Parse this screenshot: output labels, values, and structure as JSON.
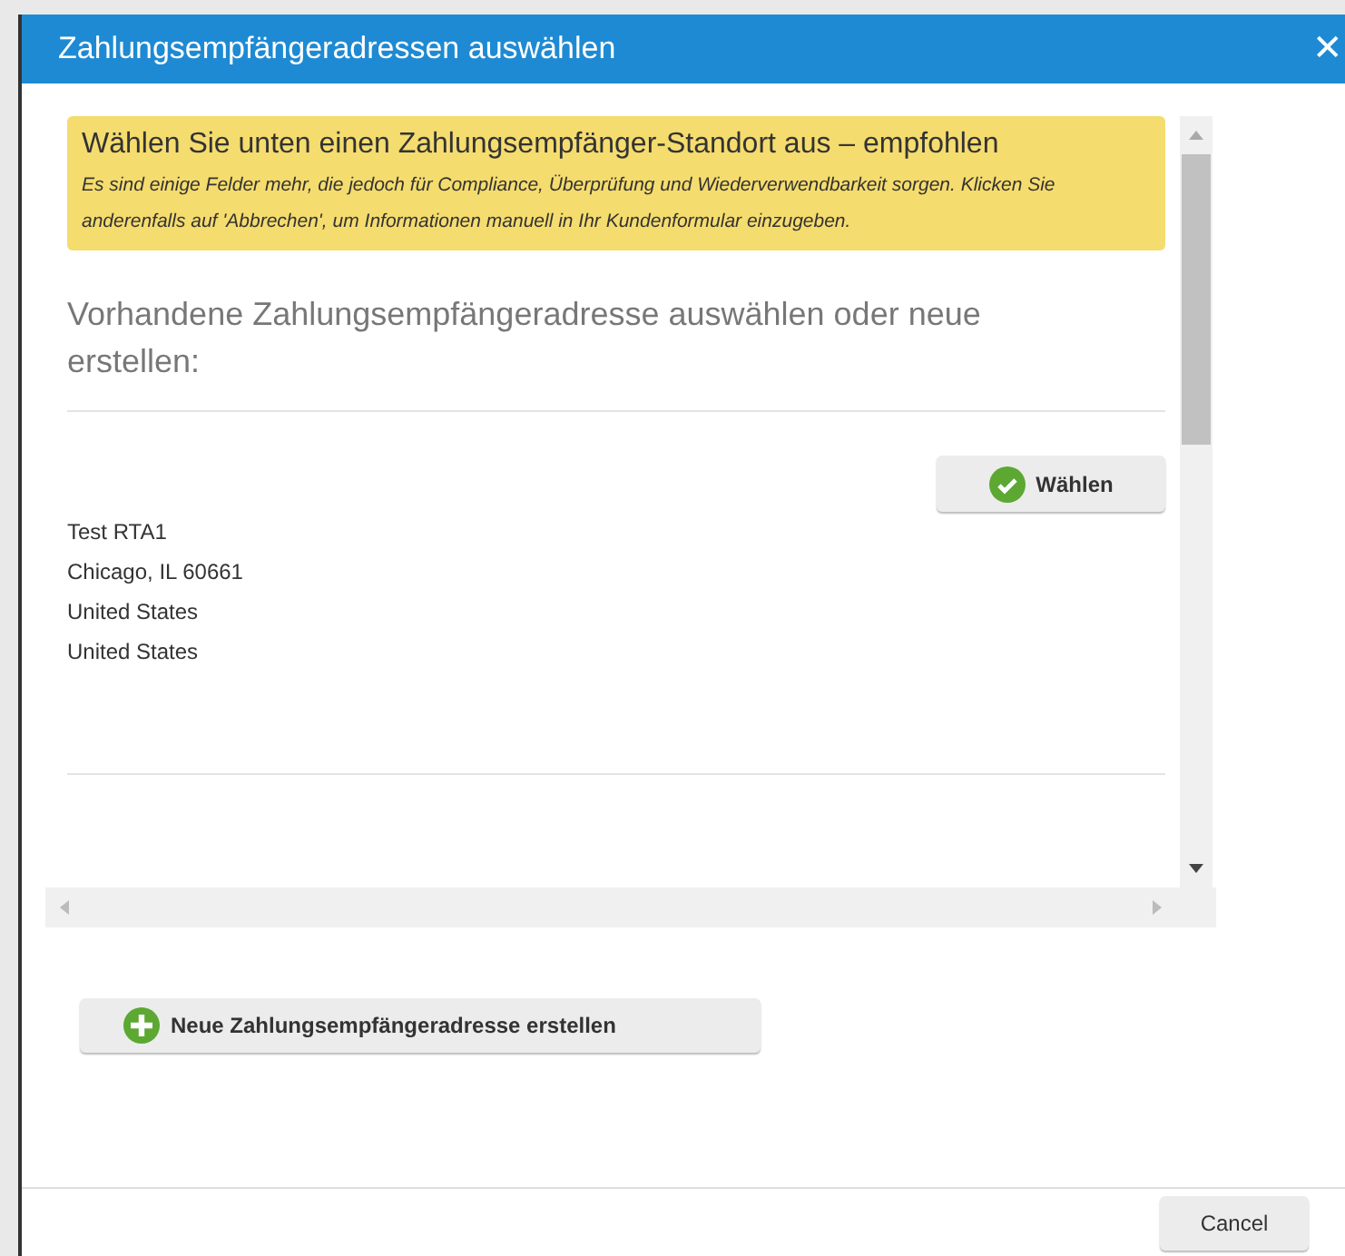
{
  "dialog": {
    "title": "Zahlungsempfängeradressen auswählen",
    "close": "✕"
  },
  "notice": {
    "heading": "Wählen Sie unten einen Zahlungsempfänger-Standort aus – empfohlen",
    "text": "Es sind einige Felder mehr, die jedoch für Compliance, Überprüfung und Wiederverwendbarkeit sorgen. Klicken Sie anderenfalls auf 'Abbrechen', um Informationen manuell in Ihr Kundenformular einzugeben."
  },
  "section_heading": "Vorhandene Zahlungsempfängeradresse auswählen oder neue erstellen:",
  "addresses": [
    {
      "lines": [
        "Test RTA1",
        "Chicago, IL 60661",
        "United States",
        "United States"
      ],
      "select_button": "Wählen"
    }
  ],
  "new_button": "Neue Zahlungsempfängeradresse erstellen",
  "footer": {
    "cancel_button": "Cancel"
  }
}
